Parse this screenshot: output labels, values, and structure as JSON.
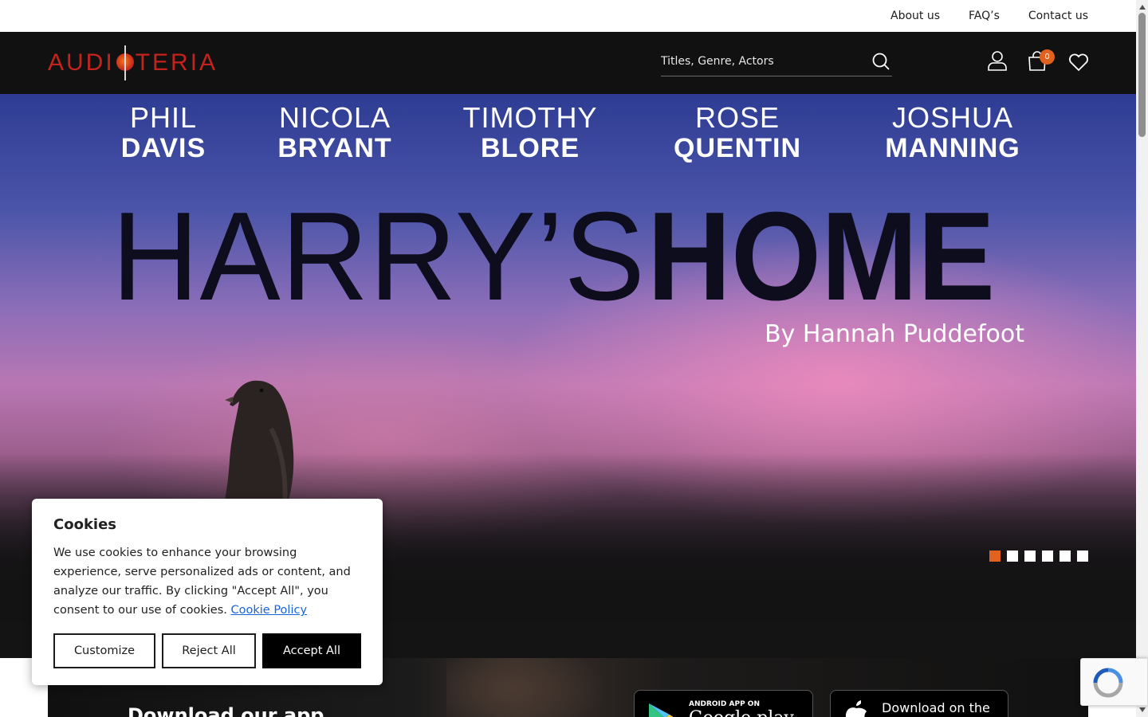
{
  "topbar": {
    "links": [
      "About us",
      "FAQ’s",
      "Contact us"
    ]
  },
  "header": {
    "logo": {
      "left": "AUDI",
      "right": "TERIA"
    },
    "search": {
      "placeholder": "Titles, Genre, Actors"
    },
    "cart_count": "0",
    "icons": [
      "user-icon",
      "shopping-bag-icon",
      "heart-icon",
      "search-icon"
    ]
  },
  "hero": {
    "cast": [
      {
        "first": "PHIL",
        "last": "DAVIS"
      },
      {
        "first": "NICOLA",
        "last": "BRYANT"
      },
      {
        "first": "TIMOTHY",
        "last": "BLORE"
      },
      {
        "first": "ROSE",
        "last": "QUENTIN"
      },
      {
        "first": "JOSHUA",
        "last": "MANNING"
      }
    ],
    "title_thin": "HARRY’S",
    "title_bold": "HOME",
    "byline": "By Hannah Puddefoot",
    "slides_total": 6,
    "slide_active": 1
  },
  "app_section": {
    "heading": "Download our app",
    "google_play": {
      "small": "ANDROID APP ON",
      "big": "Google play"
    },
    "app_store": {
      "line1": "Download on the"
    }
  },
  "cookie": {
    "title": "Cookies",
    "body": "We use cookies to enhance your browsing experience, serve personalized ads or content, and analyze our traffic. By clicking \"Accept All\", you consent to our use of cookies.",
    "policy_link": "Cookie Policy",
    "buttons": {
      "customize": "Customize",
      "reject": "Reject All",
      "accept": "Accept All"
    }
  },
  "colors": {
    "brand_red": "#c4231d",
    "accent_orange": "#e0621e",
    "header_bg": "#111111",
    "link_blue": "#1863dc"
  }
}
